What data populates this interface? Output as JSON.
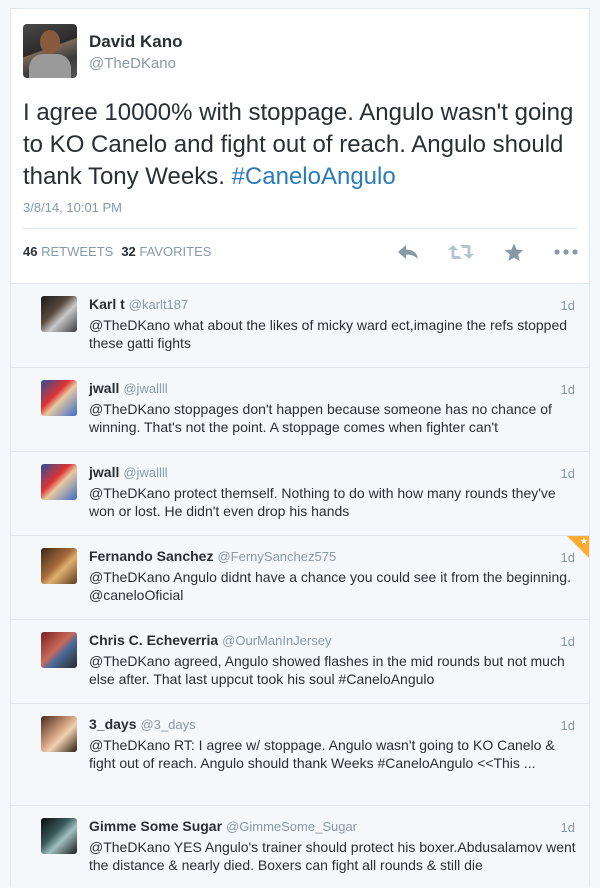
{
  "tweet": {
    "author_name": "David Kano",
    "author_handle": "@TheDKano",
    "text_main": "I agree 10000% with stoppage. Angulo wasn't going to KO Canelo and fight out of reach. Angulo should thank Tony Weeks. ",
    "hashtag": "#CaneloAngulo",
    "timestamp": "3/8/14, 10:01 PM",
    "retweets_count": "46",
    "retweets_label": "RETWEETS",
    "favorites_count": "32",
    "favorites_label": "FAVORITES"
  },
  "icons": {
    "reply": "reply-icon",
    "retweet": "retweet-icon",
    "favorite": "star-icon",
    "more": "more-icon"
  },
  "colors": {
    "link": "#2b7bb9",
    "muted": "#8899a6",
    "text": "#292f33",
    "favorite_badge": "#ffac33"
  },
  "replies": [
    {
      "name": "Karl t",
      "handle": "@karlt187",
      "time": "1d",
      "text": "@TheDKano what about the likes of micky ward ect,imagine the refs stopped these gatti fights"
    },
    {
      "name": "jwall",
      "handle": "@jwallll",
      "time": "1d",
      "text": "@TheDKano stoppages don't happen because someone has no chance of winning. That's not the point. A stoppage comes when fighter can't"
    },
    {
      "name": "jwall",
      "handle": "@jwallll",
      "time": "1d",
      "text": "@TheDKano protect themself. Nothing to do with how many rounds they've won or lost. He didn't even drop his hands"
    },
    {
      "name": "Fernando Sanchez",
      "handle": "@FernySanchez575",
      "time": "1d",
      "text": "@TheDKano Angulo didnt have a chance you could see it from the beginning. @caneloOficial"
    },
    {
      "name": "Chris C. Echeverria",
      "handle": "@OurManInJersey",
      "time": "1d",
      "text": "@TheDKano agreed, Angulo showed flashes in the mid rounds but not much else after. That last uppcut took his soul #CaneloAngulo"
    },
    {
      "name": "3_days",
      "handle": "@3_days",
      "time": "1d",
      "text": "@TheDKano RT: I agree w/ stoppage. Angulo wasn't going to KO Canelo & fight out of reach. Angulo should thank Weeks #CaneloAngulo <<This ..."
    },
    {
      "name": "Gimme Some Sugar",
      "handle": "@GimmeSome_Sugar",
      "time": "1d",
      "text": "@TheDKano YES Angulo's trainer should protect his boxer.Abdusalamov went the distance & nearly died. Boxers can fight all rounds & still die"
    }
  ]
}
